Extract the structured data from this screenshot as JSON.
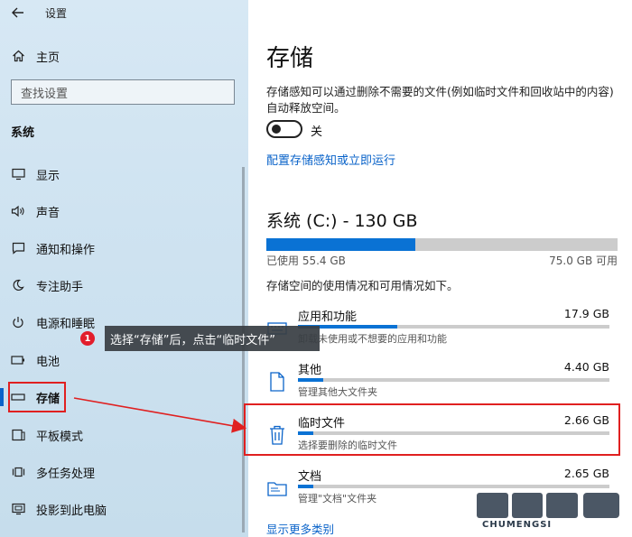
{
  "window": {
    "title": "设置"
  },
  "sidebar": {
    "home_label": "主页",
    "search_placeholder": "查找设置",
    "section_title": "系统",
    "items": [
      {
        "label": "显示",
        "icon": "monitor-icon"
      },
      {
        "label": "声音",
        "icon": "speaker-icon"
      },
      {
        "label": "通知和操作",
        "icon": "notification-icon"
      },
      {
        "label": "专注助手",
        "icon": "moon-icon"
      },
      {
        "label": "电源和睡眠",
        "icon": "power-icon"
      },
      {
        "label": "电池",
        "icon": "battery-icon"
      },
      {
        "label": "存储",
        "icon": "storage-icon",
        "selected": true
      },
      {
        "label": "平板模式",
        "icon": "tablet-icon"
      },
      {
        "label": "多任务处理",
        "icon": "multitask-icon"
      },
      {
        "label": "投影到此电脑",
        "icon": "project-icon"
      }
    ]
  },
  "content": {
    "title": "存储",
    "description": "存储感知可以通过删除不需要的文件(例如临时文件和回收站中的内容)自动释放空间。",
    "toggle_label": "关",
    "toggle_on": false,
    "config_link": "配置存储感知或立即运行",
    "drive_title": "系统 (C:) - 130 GB",
    "used_label": "已使用 55.4 GB",
    "available_label": "75.0 GB 可用",
    "used_fraction": 0.425,
    "usage_desc": "存储空间的使用情况和可用情况如下。",
    "categories": [
      {
        "name": "应用和功能",
        "size": "17.9 GB",
        "sub": "卸载未使用或不想要的应用和功能",
        "fraction": 0.32,
        "icon": "keyboard-icon"
      },
      {
        "name": "其他",
        "size": "4.40 GB",
        "sub": "管理其他大文件夹",
        "fraction": 0.08,
        "icon": "document-icon"
      },
      {
        "name": "临时文件",
        "size": "2.66 GB",
        "sub": "选择要删除的临时文件",
        "fraction": 0.05,
        "icon": "trash-icon"
      },
      {
        "name": "文档",
        "size": "2.65 GB",
        "sub": "管理\"文档\"文件夹",
        "fraction": 0.05,
        "icon": "folder-icon"
      }
    ],
    "more_link": "显示更多类别"
  },
  "callout": {
    "badge": "1",
    "text": "选择“存储”后，点击“临时文件”"
  },
  "colors": {
    "accent": "#0a72d4",
    "link": "#0a63c9",
    "highlight": "#e02020"
  },
  "watermark": {
    "text": "CHUMENGSI"
  }
}
